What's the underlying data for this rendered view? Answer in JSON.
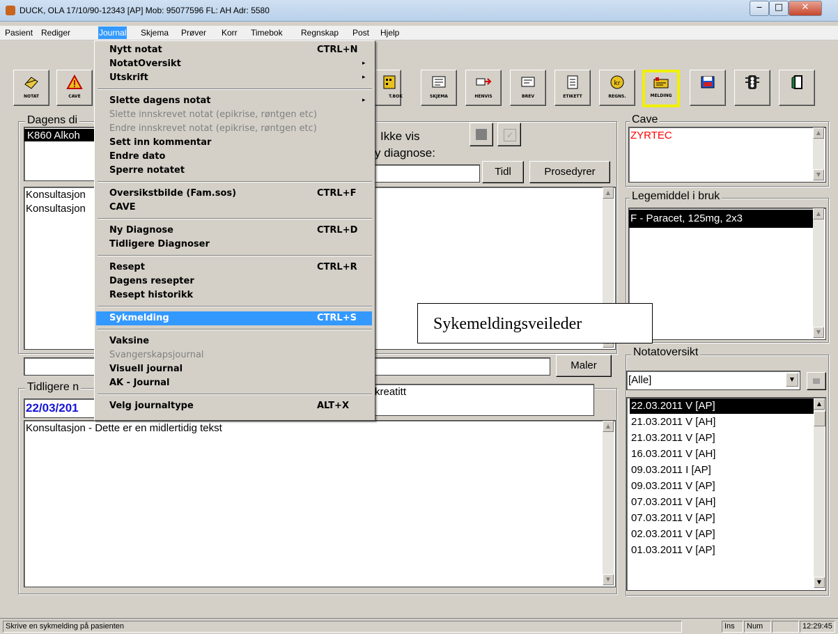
{
  "window": {
    "title": "DUCK, OLA 17/10/90-12343 [AP] Mob: 95077596 FL: AH Adr: 5580"
  },
  "menubar": [
    "Pasient",
    "Rediger",
    "Journal",
    "Skjema",
    "Prøver",
    "Korr",
    "Timebok",
    "Regnskap",
    "Post",
    "Hjelp"
  ],
  "toolbar": [
    "NOTAT",
    "CAVE",
    "T.BOK",
    "SKJEMA",
    "HENVIS",
    "BREV",
    "ETIKETT",
    "REGNS.",
    "MELDING"
  ],
  "journal_menu": [
    {
      "label": "Nytt notat",
      "shortcut": "CTRL+N"
    },
    {
      "label": "NotatOversikt",
      "submenu": "▸"
    },
    {
      "label": "Utskrift",
      "submenu": "▸"
    },
    {
      "label": "Slette dagens notat",
      "submenu": "▸"
    },
    {
      "label": "Slette innskrevet notat (epikrise, røntgen etc)"
    },
    {
      "label": "Endre innskrevet notat (epikrise, røntgen etc)"
    },
    {
      "label": "Sett inn kommentar"
    },
    {
      "label": "Endre dato"
    },
    {
      "label": "Sperre notatet"
    },
    {
      "label": "Oversikstbilde (Fam.sos)",
      "shortcut": "CTRL+F"
    },
    {
      "label": "CAVE"
    },
    {
      "label": "Ny Diagnose",
      "shortcut": "CTRL+D"
    },
    {
      "label": "Tidligere Diagnoser"
    },
    {
      "label": "Resept",
      "shortcut": "CTRL+R"
    },
    {
      "label": "Dagens resepter"
    },
    {
      "label": "Resept historikk"
    },
    {
      "label": "Sykmelding",
      "shortcut": "CTRL+S"
    },
    {
      "label": "Vaksine"
    },
    {
      "label": "Svangerskapsjournal"
    },
    {
      "label": "Visuell journal"
    },
    {
      "label": "AK - Journal"
    },
    {
      "label": "Velg journaltype",
      "shortcut": "ALT+X"
    }
  ],
  "dagens": {
    "title": "Dagens di",
    "diag": "K860  Alkoh",
    "ikke_vis": "Ikke vis",
    "ny_diag": "y diagnose:",
    "tidl": "Tidl",
    "prosedyrer": "Prosedyrer",
    "konsult1": "Konsultasjon",
    "konsult2": "Konsultasjon",
    "maler": "Maler"
  },
  "tooltip": "Sykemeldingsveileder",
  "tidligere": {
    "title": "Tidligere n",
    "date": "22/03/201",
    "diag_text": "kreatitt",
    "note_text": "Konsultasjon  - Dette er en midlertidig tekst"
  },
  "cave": {
    "title": "Cave",
    "item": "ZYRTEC",
    "item_color": "#ff0000"
  },
  "legemiddel": {
    "title": "Legemiddel i bruk",
    "item": "F - Paracet, 125mg, 2x3"
  },
  "notatoversikt": {
    "title": "Notatoversikt",
    "filter": "[Alle]",
    "notes": [
      "22.03.2011 V [AP]",
      "21.03.2011 V [AH]",
      "21.03.2011 V [AP]",
      "16.03.2011 V [AH]",
      "09.03.2011 I [AP]",
      "09.03.2011 V [AP]",
      "07.03.2011 V [AH]",
      "07.03.2011 V [AP]",
      "02.03.2011 V [AP]",
      "01.03.2011 V [AP]"
    ]
  },
  "status": {
    "text": "Skrive en sykmelding på pasienten",
    "ins": "Ins",
    "num": "Num",
    "time": "12:29:45"
  }
}
